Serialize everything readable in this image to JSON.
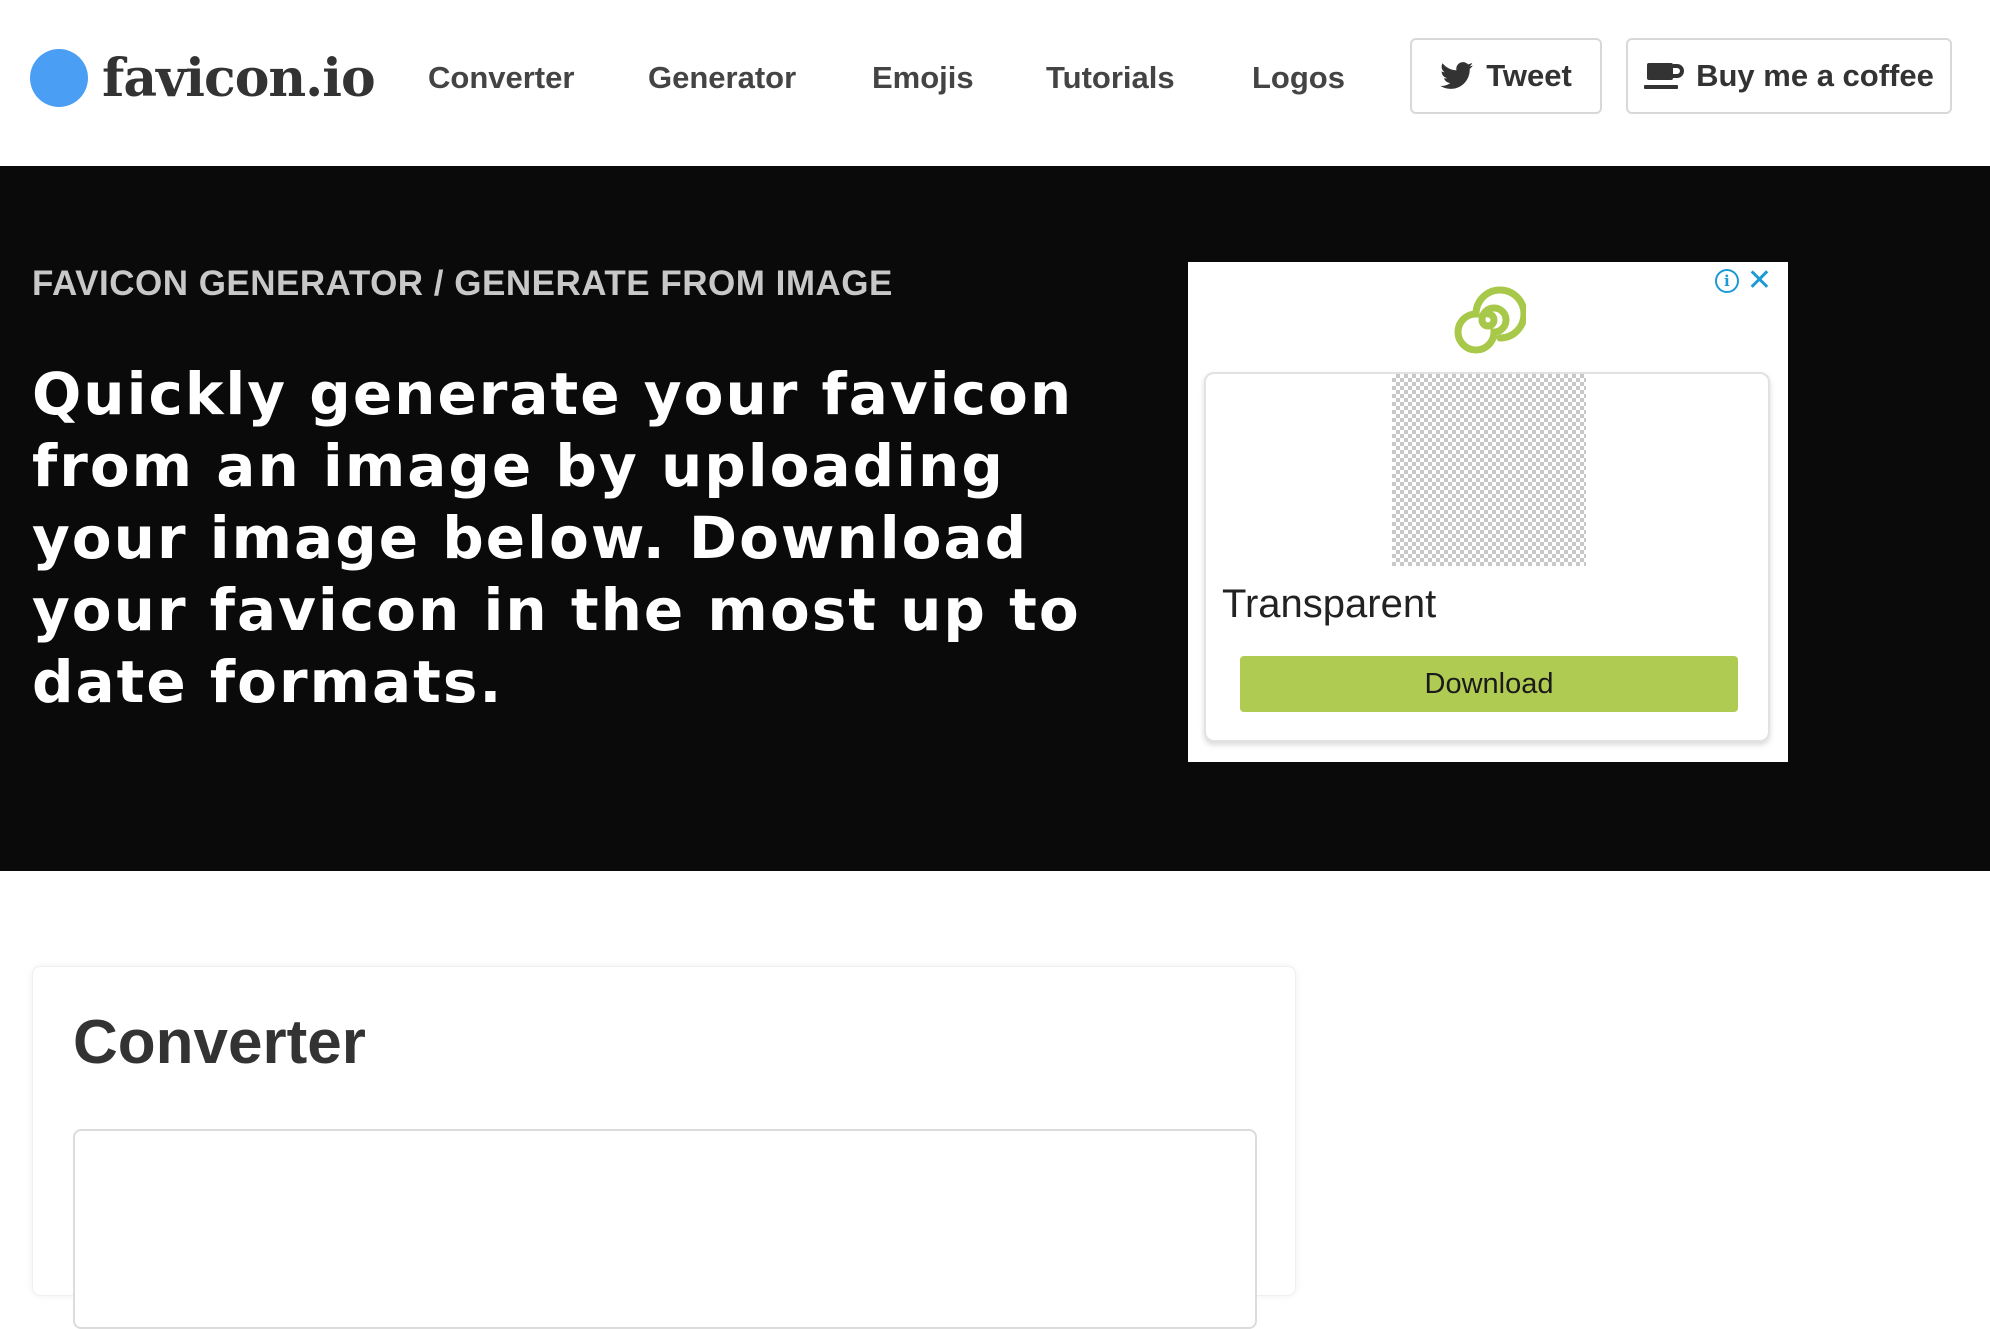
{
  "header": {
    "logo_text": "favicon.io",
    "nav": [
      "Converter",
      "Generator",
      "Emojis",
      "Tutorials",
      "Logos"
    ],
    "tweet_label": "Tweet",
    "coffee_label": "Buy me a coffee"
  },
  "hero": {
    "breadcrumb": "FAVICON GENERATOR / GENERATE FROM IMAGE",
    "title": "Quickly generate your favicon from an image by uploading your image below. Download your favicon in the most up to date formats."
  },
  "ad": {
    "product_label": "Transparent",
    "download_label": "Download",
    "info_glyph": "i",
    "close_glyph": "✕"
  },
  "converter": {
    "title": "Converter"
  },
  "colors": {
    "brand_blue": "#4a9ff5",
    "hero_bg": "#0a0a0a",
    "ad_green": "#b0cb52",
    "ad_info_blue": "#1a9ad6"
  }
}
